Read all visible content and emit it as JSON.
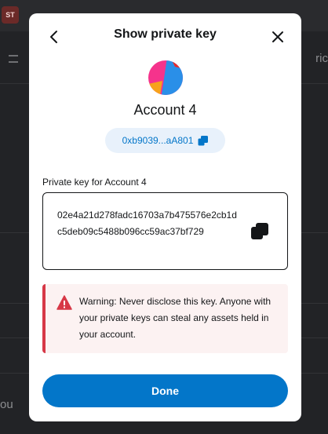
{
  "background": {
    "logo_text": "ST",
    "left_fragment": "ou",
    "right_fragment": "ric"
  },
  "modal": {
    "title": "Show private key",
    "account_name": "Account 4",
    "address": "0xb9039...aA801",
    "field_label": "Private key for Account 4",
    "private_key": "02e4a21d278fadc16703a7b475576e2cb1dc5deb09c5488b096cc59ac37bf729",
    "warning": "Warning: Never disclose this key. Anyone with your private keys can steal any assets held in your account.",
    "done_label": "Done"
  },
  "colors": {
    "accent": "#0376c9",
    "danger": "#d73847",
    "warning_bg": "#fcf2f2",
    "pill_bg": "#e8f1fb"
  },
  "icons": {
    "back": "arrow-left-icon",
    "close": "close-icon",
    "copy": "copy-icon",
    "warning": "warning-icon"
  }
}
